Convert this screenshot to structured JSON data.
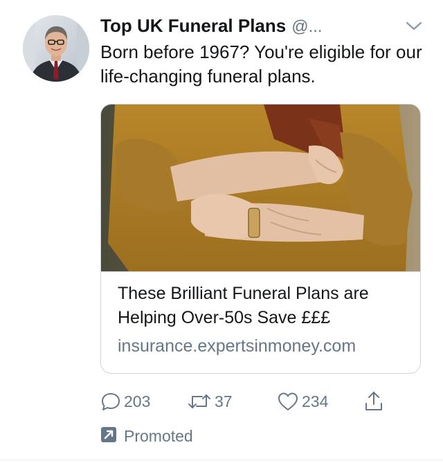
{
  "tweet": {
    "author": {
      "name": "Top UK Funeral Plans",
      "handle": "@..."
    },
    "text": "Born before 1967? You're eligible for our life-changing funeral plans.",
    "card": {
      "title": "These Brilliant Funeral Plans are Helping Over-50s Save £££",
      "domain": "insurance.expertsinmoney.com"
    },
    "actions": {
      "replies": "203",
      "retweets": "37",
      "likes": "234"
    },
    "promoted_label": "Promoted"
  },
  "colors": {
    "text_primary": "#14171a",
    "text_secondary": "#657786",
    "border": "#ccd6dd"
  },
  "icons": [
    "chevron-down-icon",
    "reply-icon",
    "retweet-icon",
    "like-icon",
    "share-icon",
    "promoted-icon"
  ]
}
